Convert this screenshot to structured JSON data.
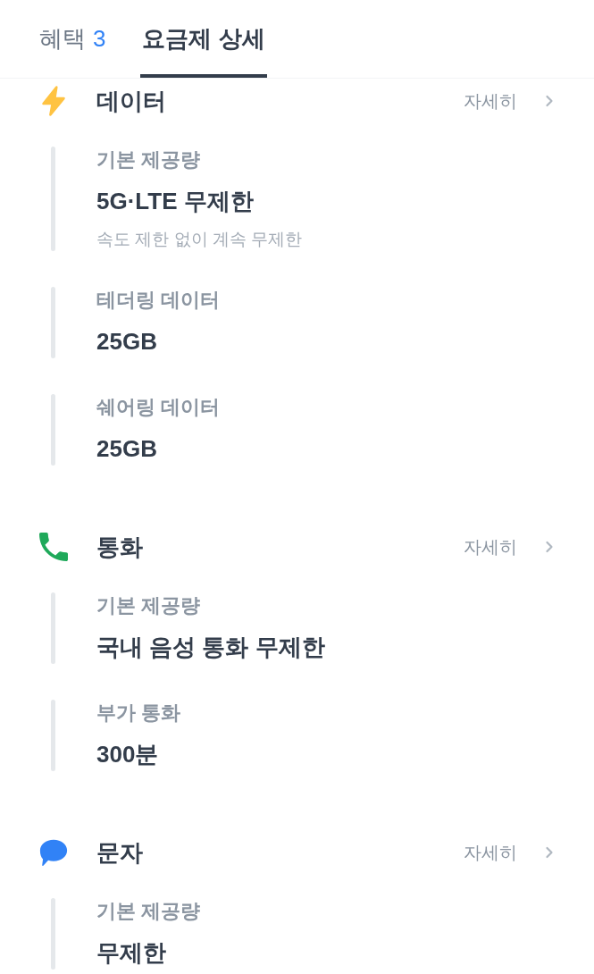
{
  "tabs": [
    {
      "label": "혜택",
      "count": "3",
      "selected": false
    },
    {
      "label": "요금제 상세",
      "selected": true
    }
  ],
  "sections": [
    {
      "kind": "data",
      "title": "데이터",
      "detail_link": "자세히",
      "items": [
        {
          "label": "기본 제공량",
          "value": "5G·LTE 무제한",
          "note": "속도 제한 없이 계속 무제한"
        },
        {
          "label": "테더링 데이터",
          "value": "25GB"
        },
        {
          "label": "쉐어링 데이터",
          "value": "25GB"
        }
      ]
    },
    {
      "kind": "call",
      "title": "통화",
      "detail_link": "자세히",
      "items": [
        {
          "label": "기본 제공량",
          "value": "국내 음성 통화 무제한"
        },
        {
          "label": "부가 통화",
          "value": "300분"
        }
      ]
    },
    {
      "kind": "message",
      "title": "문자",
      "detail_link": "자세히",
      "items": [
        {
          "label": "기본 제공량",
          "value": "무제한"
        }
      ]
    }
  ]
}
